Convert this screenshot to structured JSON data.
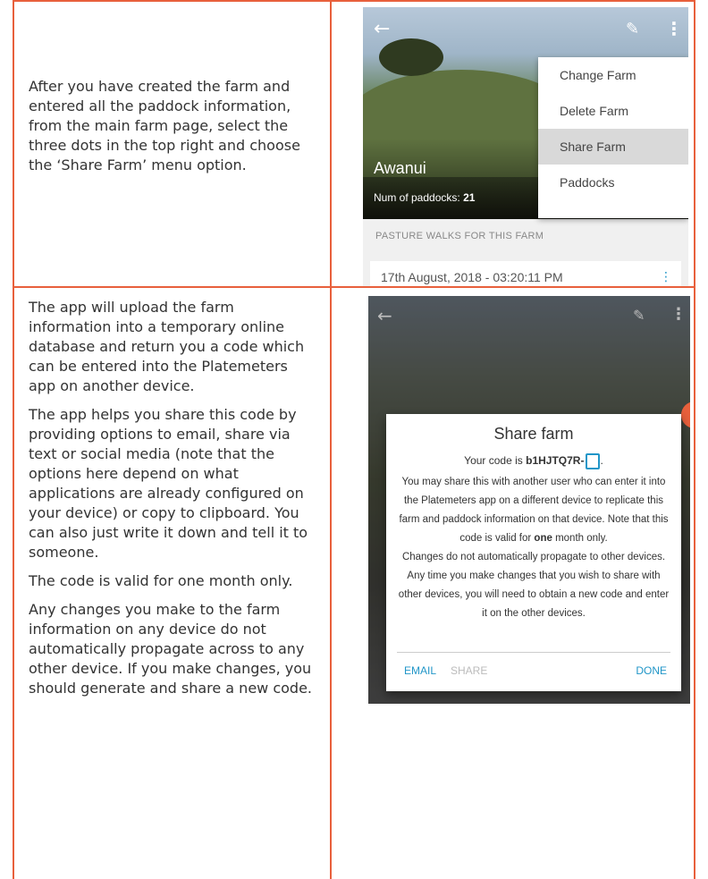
{
  "intro": "After you have created the farm and entered all the paddock information, from the main farm page, select the three dots in the top right and choose the ‘Share Farm’ menu option.",
  "instructions": [
    "The app will upload the farm information into a temporary online database and return you a code which can be entered into the Platemeters app on another device.",
    "The app helps you share this code by providing options to email, share via text or social media (note that the options here depend on what applications are already configured on your device) or copy to clipboard. You can also just write it down and tell it to someone.",
    "The code is valid for one month only.",
    "Any changes you make to the farm information on any device do not automatically propagate across to any other device. If you make changes, you should generate and share a new code."
  ],
  "screen1": {
    "farm_name": "Awanui",
    "paddocks_label": "Num of paddocks:",
    "paddocks_count": "21",
    "menu": [
      "Change Farm",
      "Delete Farm",
      "Share Farm",
      "Paddocks"
    ],
    "walks_header": "PASTURE WALKS FOR THIS FARM",
    "walk_row": "17th August, 2018 - 03:20:11 PM"
  },
  "screen2": {
    "dialog_title": "Share farm",
    "code_prefix": "Your code is",
    "code": "b1HJTQ7R-",
    "code_suffix": ".",
    "body_1": "You may share this with another user who can enter it into the Platemeters app on a different device to replicate this farm and paddock information on that device. Note that this code is valid for",
    "body_bold": "one",
    "body_2": "month only.",
    "body_3": "Changes do not automatically propagate to other devices. Any time you make changes that you wish to share with other devices, you will need to obtain a new code and enter it on the other devices.",
    "btn_email": "EMAIL",
    "btn_share": "SHARE",
    "btn_done": "DONE"
  },
  "colors": {
    "border": "#e8603c",
    "accent": "#2196c8"
  }
}
